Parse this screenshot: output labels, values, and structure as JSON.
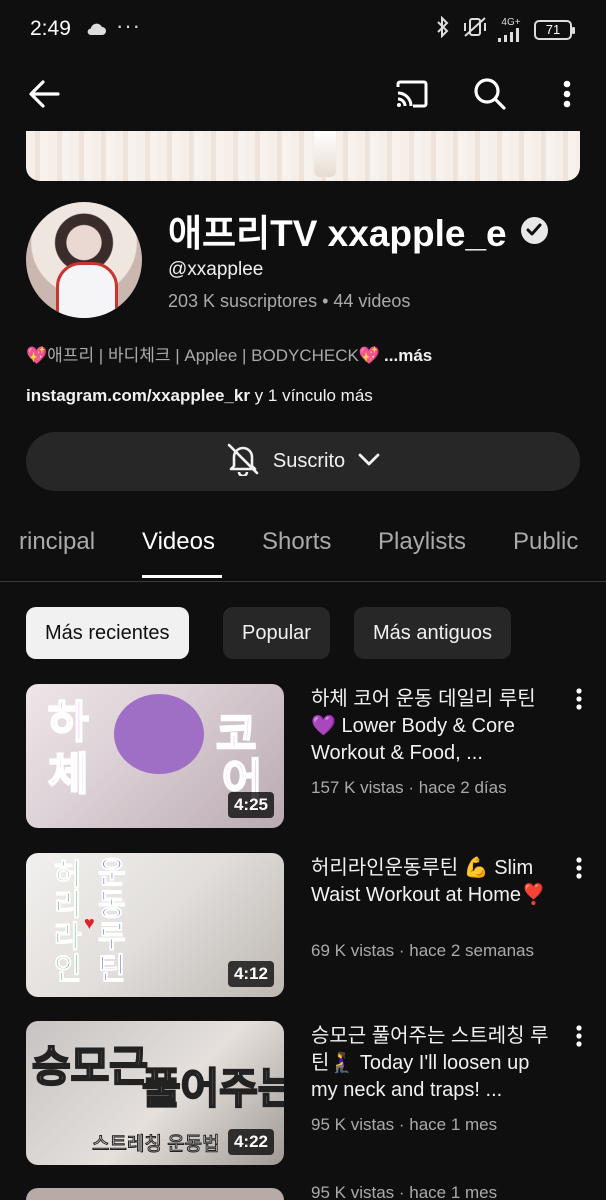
{
  "status_bar": {
    "time": "2:49",
    "dots": "···",
    "network": "4G+",
    "battery": "71"
  },
  "app_bar": {
    "icons": [
      "back-arrow-icon",
      "cast-icon",
      "search-icon",
      "more-vert-icon"
    ]
  },
  "channel": {
    "name": "애프리TV xxapple_e",
    "handle": "@xxapplee",
    "stats": "203 K suscriptores • 44 videos",
    "description": "💖애프리 | 바디체크 | Applee |  BODYCHECK💖",
    "description_more": "...más",
    "links_url": "instagram.com/xxapplee_kr",
    "links_suffix": " y 1 vínculo más",
    "subscribe_label": "Suscrito"
  },
  "tabs": [
    {
      "label": "rincipal"
    },
    {
      "label": "Videos",
      "active": true
    },
    {
      "label": "Shorts"
    },
    {
      "label": "Playlists"
    },
    {
      "label": "Public"
    }
  ],
  "chips": [
    {
      "label": "Más recientes",
      "active": true
    },
    {
      "label": "Popular"
    },
    {
      "label": "Más antiguos"
    }
  ],
  "videos": [
    {
      "title": "하체 코어 운동 데일리 루틴 💜 Lower Body & Core Workout  & Food, ...",
      "meta": "157 K vistas · hace 2 días",
      "duration": "4:25",
      "thumb_text": [
        "하",
        "체",
        "코",
        "어"
      ]
    },
    {
      "title": "허리라인운동루틴 💪 Slim Waist Workout at Home❣️",
      "meta": "69 K vistas · hace 2 semanas",
      "duration": "4:12",
      "thumb_text": [
        "허",
        "리",
        "라",
        "인",
        "운",
        "동",
        "루",
        "틴"
      ]
    },
    {
      "title": "승모근 풀어주는 스트레칭 루틴🧎‍♀️ Today I'll loosen up my neck and traps! ...",
      "meta": "95 K vistas · hace 1 mes",
      "duration": "4:22",
      "thumb_text": [
        "승모근",
        "풀어주는",
        "스트레칭 운동법"
      ]
    }
  ],
  "partial_video_meta": "95 K vistas · hace 1 mes"
}
